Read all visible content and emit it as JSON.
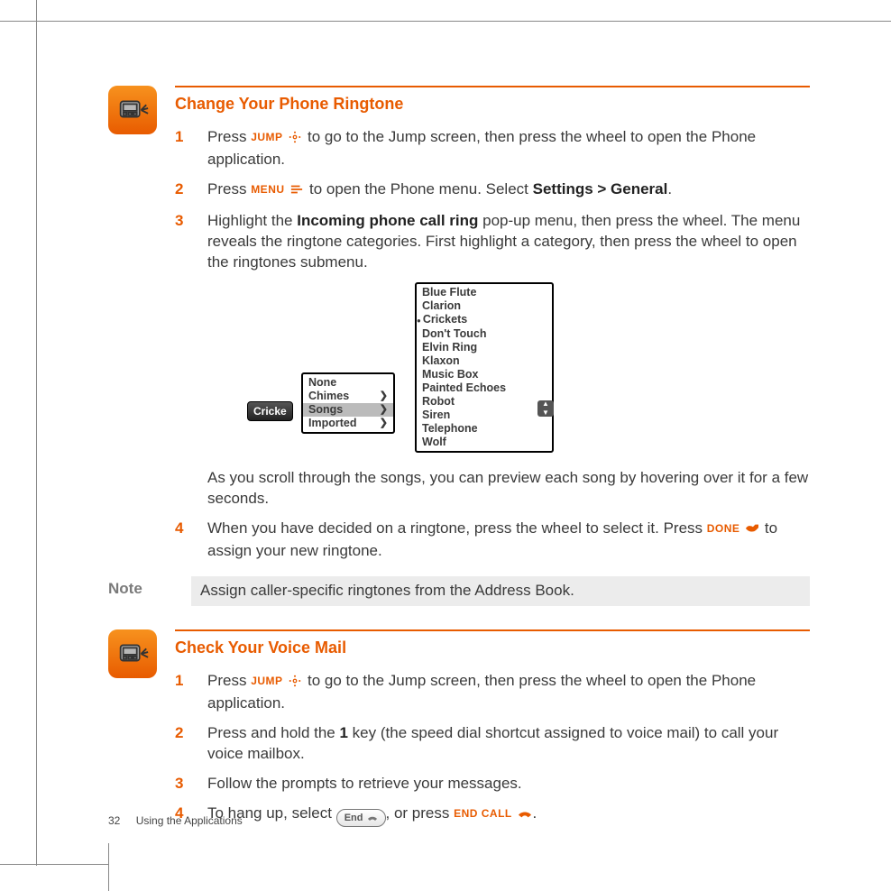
{
  "section1": {
    "title": "Change Your Phone Ringtone",
    "step1a": "Press ",
    "step1_btn": "JUMP",
    "step1b": " to go to the Jump screen, then press the wheel to open the Phone application.",
    "step2a": "Press ",
    "step2_btn": "MENU",
    "step2b": " to open the Phone menu. Select ",
    "step2_bold": "Settings > General",
    "step2c": ".",
    "step3a": "Highlight the ",
    "step3_bold": "Incoming phone call ring",
    "step3b": " pop-up menu, then press the wheel. The menu reveals the ringtone categories. First highlight a category, then press the wheel to open the ringtones submenu.",
    "after_diagram": "As you scroll through the songs, you can preview each song by hovering over it for a few seconds.",
    "step4a": "When you have decided on a ringtone, press the wheel to select it. Press ",
    "step4_btn": "DONE",
    "step4b": " to assign your new ringtone."
  },
  "diagram": {
    "btn": "Cricke",
    "main": [
      "None",
      "Chimes",
      "Songs",
      "Imported"
    ],
    "sub": [
      "Blue Flute",
      "Clarion",
      "Crickets",
      "Don't Touch",
      "Elvin Ring",
      "Klaxon",
      "Music Box",
      "Painted Echoes",
      "Robot",
      "Siren",
      "Telephone",
      "Wolf"
    ]
  },
  "note": {
    "label": "Note",
    "body": "Assign caller-specific ringtones from the Address Book."
  },
  "section2": {
    "title": "Check Your Voice Mail",
    "step1a": "Press ",
    "step1_btn": "JUMP",
    "step1b": " to go to the Jump screen, then press the wheel to open the Phone application.",
    "step2a": "Press and hold the ",
    "step2_bold": "1",
    "step2b": " key (the speed dial shortcut assigned to voice mail) to call your voice mailbox.",
    "step3": "Follow the prompts to retrieve your messages.",
    "step4a": "To hang up, select ",
    "step4_endlabel": "End",
    "step4b": ", or press ",
    "step4_btn": "END CALL",
    "step4c": "."
  },
  "footer": {
    "page": "32",
    "title": "Using the Applications"
  }
}
